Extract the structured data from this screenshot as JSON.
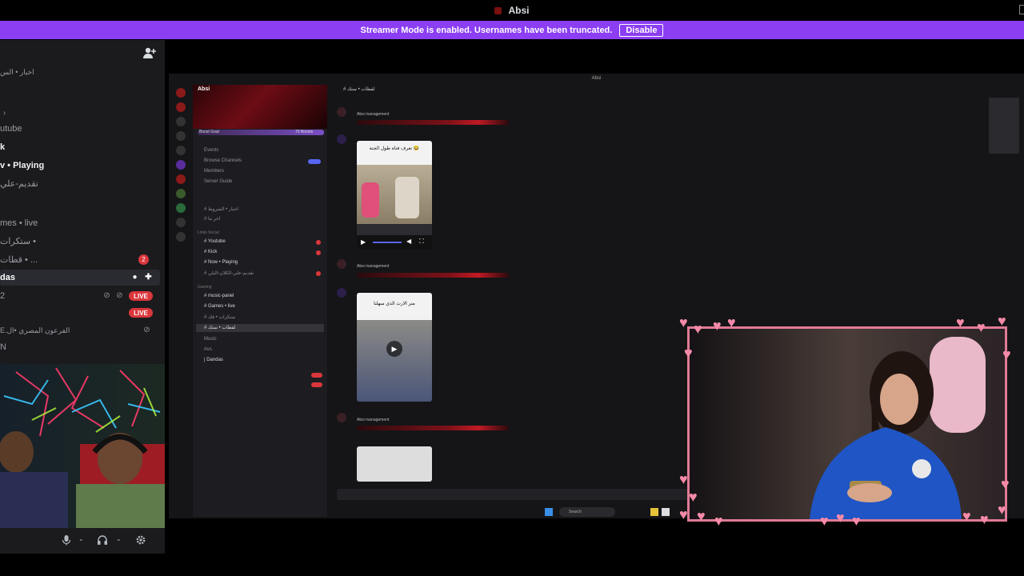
{
  "window": {
    "title": "Absi"
  },
  "banner": {
    "message": "Streamer Mode is enabled. Usernames have been truncated.",
    "disable_label": "Disable"
  },
  "left_panel": {
    "header_text": "اخبار • الس",
    "items": [
      {
        "label": "utube",
        "style": "muted"
      },
      {
        "label": "k",
        "style": "bright"
      },
      {
        "label": "v • Playing",
        "style": "bright"
      },
      {
        "label": "تقديم-علي",
        "style": "muted"
      },
      {
        "label": "mes • live",
        "style": "muted"
      },
      {
        "label": "ستكرات •",
        "style": "muted"
      },
      {
        "label": "قطات • ...",
        "style": "muted",
        "badge": "2"
      },
      {
        "label": "das",
        "style": "selected"
      },
      {
        "label": "2",
        "style": "muted",
        "live": "LIVE"
      },
      {
        "label": "",
        "style": "muted",
        "live": "LIVE"
      },
      {
        "label": "E.الفرعون المصري •ال",
        "style": "muted"
      },
      {
        "label": "N",
        "style": "muted"
      }
    ]
  },
  "shared_screen": {
    "title": "Absi",
    "server_name": "Absi",
    "boost_label": "Boost Goal",
    "boost_count": "70 Boosts",
    "nav": [
      "Events",
      "Browse Channels",
      "Members",
      "Server Guide"
    ],
    "new_badge": "NEW",
    "channels": [
      {
        "label": "# اخبار • الشروط",
        "bright": false
      },
      {
        "label": "# اخر ما",
        "bright": false
      },
      {
        "label": "Links Social",
        "category": true
      },
      {
        "label": "# Youtube",
        "bright": true
      },
      {
        "label": "# Kick",
        "bright": true
      },
      {
        "label": "# Now • Playing",
        "bright": true
      },
      {
        "label": "# تقديم-علي-الكلان-البلي",
        "bright": false
      },
      {
        "label": "Gaming",
        "category": true
      },
      {
        "label": "# music-panel",
        "bright": true
      },
      {
        "label": "# Games • live",
        "bright": true
      },
      {
        "label": "# ستكرات • فك",
        "bright": false
      },
      {
        "label": "# لقطات • سنك",
        "bright": true
      },
      {
        "label": "Music",
        "bright": false
      },
      {
        "label": "Avs",
        "bright": false
      },
      {
        "label": "| Dandas",
        "bright": true
      }
    ],
    "channel_header": "# لقطات • سنك",
    "messages": [
      {
        "caption": "Absi management"
      },
      {
        "caption": "Absi management"
      },
      {
        "caption": "Absi management"
      }
    ],
    "video_caption_1": "تعرف فتاة طول الجنة 😂",
    "video_caption_2": "متر الارث الذي سهلنا",
    "taskbar_search": "Search"
  }
}
